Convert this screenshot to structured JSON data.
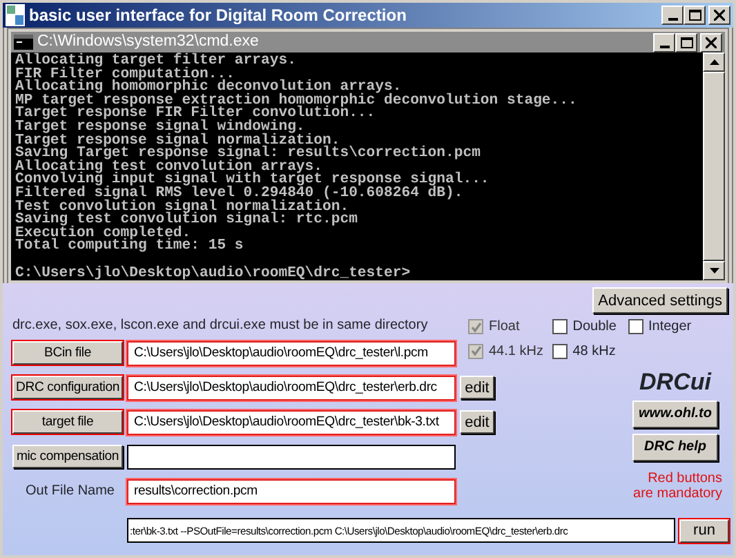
{
  "window": {
    "title": "basic user interface for Digital Room Correction"
  },
  "console": {
    "title": "C:\\Windows\\system32\\cmd.exe",
    "lines": [
      "Allocating target filter arrays.",
      "FIR Filter computation...",
      "Allocating homomorphic deconvolution arrays.",
      "MP target response extraction homomorphic deconvolution stage...",
      "Target response FIR Filter convolution...",
      "Target response signal windowing.",
      "Target response signal normalization.",
      "Saving Target response signal: results\\correction.pcm",
      "Allocating test convolution arrays.",
      "Convolving input signal with target response signal...",
      "Filtered signal RMS level 0.294840 (-10.608264 dB).",
      "Test convolution signal normalization.",
      "Saving test convolution signal: rtc.pcm",
      "Execution completed.",
      "Total computing time: 15 s"
    ],
    "prompt": "C:\\Users\\jlo\\Desktop\\audio\\roomEQ\\drc_tester>"
  },
  "advanced_button": "Advanced settings",
  "note": "drc.exe, sox.exe, lscon.exe and drcui.exe must be in same directory",
  "format_options": [
    {
      "label": "Float",
      "checked": true,
      "disabled": true
    },
    {
      "label": "Double",
      "checked": false,
      "disabled": false
    },
    {
      "label": "Integer",
      "checked": false,
      "disabled": false
    }
  ],
  "rate_options": [
    {
      "label": "44.1 kHz",
      "checked": true,
      "disabled": true
    },
    {
      "label": "48 kHz",
      "checked": false,
      "disabled": false
    }
  ],
  "file_rows": [
    {
      "kind": "button",
      "label": "BCin file",
      "required": true,
      "value": "C:\\Users\\jlo\\Desktop\\audio\\roomEQ\\drc_tester\\l.pcm",
      "field_required": true
    },
    {
      "kind": "button",
      "label": "DRC configuration",
      "required": true,
      "value": "C:\\Users\\jlo\\Desktop\\audio\\roomEQ\\drc_tester\\erb.drc",
      "field_required": true,
      "edit": "edit"
    },
    {
      "kind": "button",
      "label": "target file",
      "required": true,
      "value": "C:\\Users\\jlo\\Desktop\\audio\\roomEQ\\drc_tester\\bk-3.txt",
      "field_required": true,
      "edit": "edit"
    },
    {
      "kind": "button",
      "label": "mic compensation",
      "required": false,
      "field_required": false
    },
    {
      "kind": "label",
      "label": "Out File Name",
      "value": "results\\correction.pcm",
      "field_required": true
    }
  ],
  "logo": "DRCui",
  "links": [
    "www.ohl.to",
    "DRC help"
  ],
  "mandatory_note": [
    "Red buttons",
    "are mandatory"
  ],
  "command": {
    "value": ":ter\\bk-3.txt --PSOutFile=results\\correction.pcm C:\\Users\\jlo\\Desktop\\audio\\roomEQ\\drc_tester\\erb.drc",
    "run": "run",
    "required": true
  }
}
